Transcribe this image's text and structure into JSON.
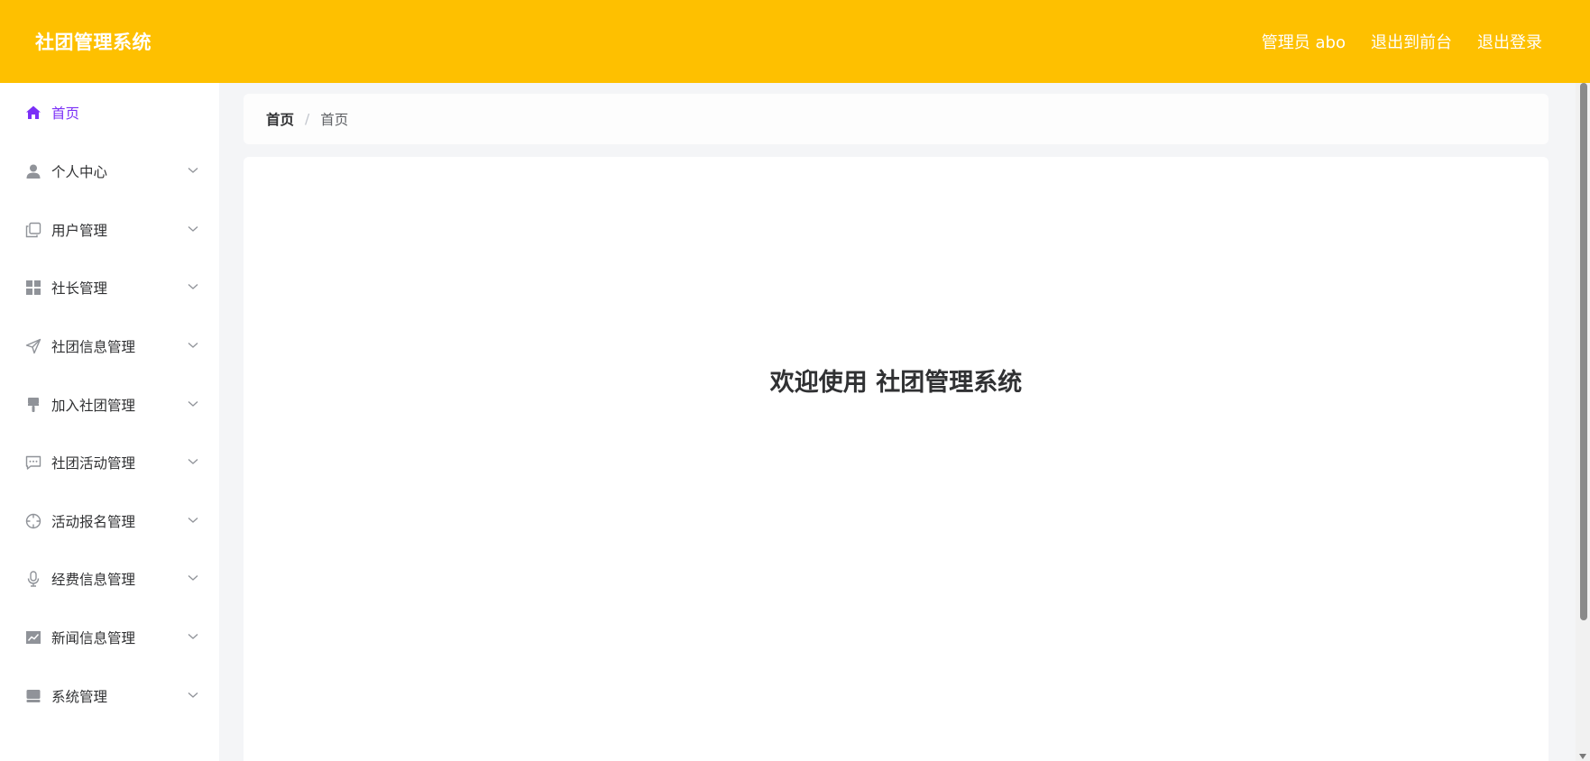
{
  "header": {
    "title": "社团管理系统",
    "admin_label": "管理员 abo",
    "front_label": "退出到前台",
    "logout_label": "退出登录"
  },
  "sidebar": {
    "items": [
      {
        "label": "首页",
        "icon": "home-icon",
        "active": true
      },
      {
        "label": "个人中心",
        "icon": "user-icon"
      },
      {
        "label": "用户管理",
        "icon": "copy-icon"
      },
      {
        "label": "社长管理",
        "icon": "grid-icon"
      },
      {
        "label": "社团信息管理",
        "icon": "send-icon"
      },
      {
        "label": "加入社团管理",
        "icon": "brush-icon"
      },
      {
        "label": "社团活动管理",
        "icon": "chat-icon"
      },
      {
        "label": "活动报名管理",
        "icon": "crosshair-icon"
      },
      {
        "label": "经费信息管理",
        "icon": "microphone-icon"
      },
      {
        "label": "新闻信息管理",
        "icon": "chart-icon"
      },
      {
        "label": "系统管理",
        "icon": "monitor-icon"
      }
    ]
  },
  "breadcrumb": {
    "home": "首页",
    "separator": "/",
    "current": "首页"
  },
  "main": {
    "welcome": "欢迎使用 社团管理系统"
  },
  "colors": {
    "header_bg": "#fec000",
    "active": "#7b2ff7"
  }
}
